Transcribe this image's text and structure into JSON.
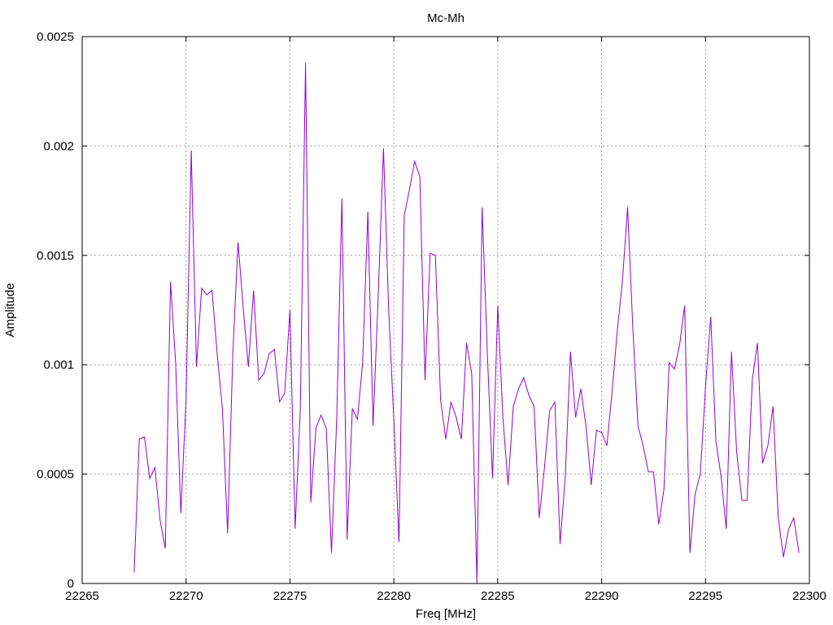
{
  "chart_data": {
    "type": "line",
    "title": "Mc-Mh",
    "xlabel": "Freq [MHz]",
    "ylabel": "Amplitude",
    "xlim": [
      22265,
      22300
    ],
    "ylim": [
      0,
      0.0025
    ],
    "xticks": [
      "22265",
      "22270",
      "22275",
      "22280",
      "22285",
      "22290",
      "22295",
      "22300"
    ],
    "yticks": [
      "0",
      "0.0005",
      "0.001",
      "0.0015",
      "0.002",
      "0.0025"
    ],
    "grid": true,
    "series": [
      {
        "color": "#9400d3",
        "x": [
          22267.5,
          22267.75,
          22268.0,
          22268.25,
          22268.5,
          22268.75,
          22269.0,
          22269.25,
          22269.5,
          22269.75,
          22270.0,
          22270.25,
          22270.5,
          22270.75,
          22271.0,
          22271.25,
          22271.5,
          22271.75,
          22272.0,
          22272.25,
          22272.5,
          22272.75,
          22273.0,
          22273.25,
          22273.5,
          22273.75,
          22274.0,
          22274.25,
          22274.5,
          22274.75,
          22275.0,
          22275.25,
          22275.5,
          22275.75,
          22276.0,
          22276.25,
          22276.5,
          22276.75,
          22277.0,
          22277.25,
          22277.5,
          22277.75,
          22278.0,
          22278.25,
          22278.5,
          22278.75,
          22279.0,
          22279.25,
          22279.5,
          22279.75,
          22280.0,
          22280.25,
          22280.5,
          22280.75,
          22281.0,
          22281.25,
          22281.5,
          22281.75,
          22282.0,
          22282.25,
          22282.5,
          22282.75,
          22283.0,
          22283.25,
          22283.5,
          22283.75,
          22284.0,
          22284.25,
          22284.5,
          22284.75,
          22285.0,
          22285.25,
          22285.5,
          22285.75,
          22286.0,
          22286.25,
          22286.5,
          22286.75,
          22287.0,
          22287.25,
          22287.5,
          22287.75,
          22288.0,
          22288.25,
          22288.5,
          22288.75,
          22289.0,
          22289.25,
          22289.5,
          22289.75,
          22290.0,
          22290.25,
          22290.5,
          22290.75,
          22291.0,
          22291.25,
          22291.5,
          22291.75,
          22292.0,
          22292.25,
          22292.5,
          22292.75,
          22293.0,
          22293.25,
          22293.5,
          22293.75,
          22294.0,
          22294.25,
          22294.5,
          22294.75,
          22295.0,
          22295.25,
          22295.5,
          22295.75,
          22296.0,
          22296.25,
          22296.5,
          22296.75,
          22297.0,
          22297.25,
          22297.5,
          22297.75,
          22298.0,
          22298.25,
          22298.5,
          22298.75,
          22299.0,
          22299.25,
          22299.5
        ],
        "y": [
          5e-05,
          0.00066,
          0.00067,
          0.00048,
          0.00053,
          0.00029,
          0.00016,
          0.00138,
          0.00101,
          0.00032,
          0.00084,
          0.00198,
          0.00099,
          0.00135,
          0.00132,
          0.00134,
          0.00105,
          0.0008,
          0.00023,
          0.00105,
          0.00156,
          0.00126,
          0.00099,
          0.00134,
          0.00093,
          0.00096,
          0.00105,
          0.00107,
          0.00083,
          0.00087,
          0.00125,
          0.00025,
          0.0008,
          0.00238,
          0.00037,
          0.00071,
          0.00077,
          0.00071,
          0.00014,
          0.00075,
          0.00176,
          0.0002,
          0.0008,
          0.00075,
          0.00101,
          0.0017,
          0.00072,
          0.00132,
          0.00199,
          0.00125,
          0.00075,
          0.00019,
          0.00168,
          0.0018,
          0.00193,
          0.00186,
          0.00093,
          0.00151,
          0.0015,
          0.00084,
          0.00066,
          0.00083,
          0.00076,
          0.00066,
          0.0011,
          0.00096,
          0.0,
          0.00172,
          0.00105,
          0.00048,
          0.00127,
          0.00076,
          0.00045,
          0.00081,
          0.00089,
          0.00094,
          0.00086,
          0.00081,
          0.0003,
          0.00053,
          0.00079,
          0.00083,
          0.00018,
          0.00049,
          0.00106,
          0.00076,
          0.00089,
          0.00072,
          0.00045,
          0.0007,
          0.00069,
          0.00063,
          0.00087,
          0.00115,
          0.00138,
          0.00172,
          0.00117,
          0.00072,
          0.00063,
          0.00051,
          0.00051,
          0.00027,
          0.00043,
          0.00101,
          0.00098,
          0.00109,
          0.00127,
          0.00014,
          0.00041,
          0.0005,
          0.0009,
          0.00122,
          0.00065,
          0.00049,
          0.00025,
          0.00106,
          0.0006,
          0.00038,
          0.00038,
          0.00093,
          0.0011,
          0.00055,
          0.00063,
          0.00081,
          0.0003,
          0.00012,
          0.00025,
          0.0003,
          0.00014
        ]
      }
    ]
  }
}
